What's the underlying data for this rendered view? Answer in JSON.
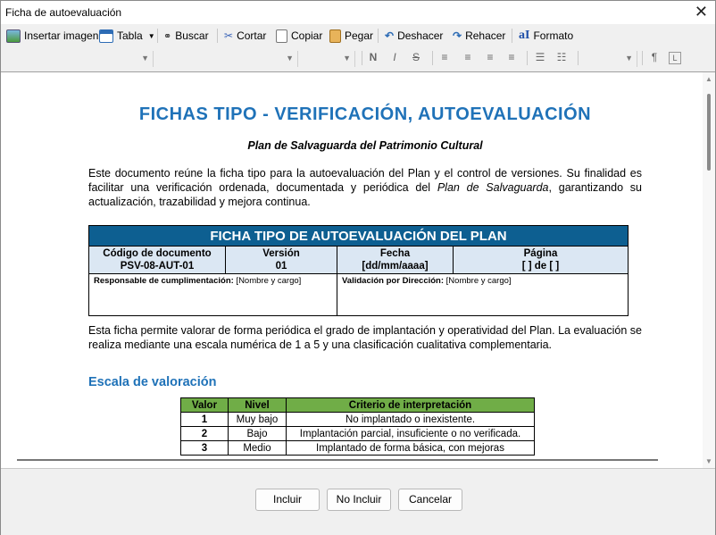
{
  "window": {
    "title": "Ficha de autoevaluación"
  },
  "toolbar": {
    "insert_image": "Insertar imagen",
    "table": "Tabla",
    "search": "Buscar",
    "cut": "Cortar",
    "copy": "Copiar",
    "paste": "Pegar",
    "undo": "Deshacer",
    "redo": "Rehacer",
    "format": "Formato"
  },
  "format_bar": {
    "bold": "N",
    "italic": "I",
    "strike": "S",
    "pilcrow": "¶"
  },
  "document": {
    "title": "FICHAS TIPO - VERIFICACIÓN, AUTOEVALUACIÓN",
    "subtitle": "Plan de Salvaguarda del Patrimonio Cultural",
    "intro_1": "Este documento reúne la ficha tipo para la autoevaluación del Plan y el control de versiones. Su finalidad es facilitar una verificación ordenada, documentada y periódica del ",
    "intro_italic": "Plan de Salvaguarda",
    "intro_2": ", garantizando su actualización, trazabilidad y mejora continua.",
    "ficha": {
      "header": "FICHA TIPO DE AUTOEVALUACIÓN DEL PLAN",
      "codigo_label": "Código de documento",
      "codigo_value": "PSV-08-AUT-01",
      "version_label": "Versión",
      "version_value": "01",
      "fecha_label": "Fecha",
      "fecha_value": "[dd/mm/aaaa]",
      "pagina_label": "Página",
      "pagina_value": "[ ] de [ ]",
      "responsable_label": "Responsable de cumplimentación:",
      "responsable_value": " [Nombre y cargo]",
      "validacion_label": "Validación por Dirección:",
      "validacion_value": " [Nombre y cargo]"
    },
    "para_2": "Esta ficha permite valorar de forma periódica el grado de implantación y operatividad del Plan. La evaluación se realiza mediante una escala numérica de 1 a 5 y una clasificación cualitativa complementaria.",
    "escala_heading": "Escala de valoración",
    "escala": {
      "headers": [
        "Valor",
        "Nivel",
        "Criterio de interpretación"
      ],
      "rows": [
        [
          "1",
          "Muy bajo",
          "No implantado o inexistente."
        ],
        [
          "2",
          "Bajo",
          "Implantación parcial, insuficiente o no verificada."
        ],
        [
          "3",
          "Medio",
          "Implantado de forma básica, con mejoras"
        ]
      ]
    }
  },
  "buttons": {
    "include": "Incluir",
    "exclude": "No Incluir",
    "cancel": "Cancelar"
  },
  "colors": {
    "heading_blue": "#1f72b8",
    "ficha_header": "#0d5f91",
    "ficha_cell": "#dbe7f3",
    "escala_header": "#70ad47"
  }
}
